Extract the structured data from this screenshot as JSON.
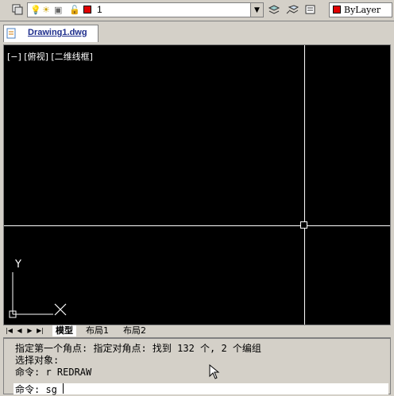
{
  "toolbar": {
    "layer_name": "1",
    "color_label": "ByLayer",
    "colors": {
      "layer_swatch": "#e00000",
      "color_swatch": "#e00000"
    }
  },
  "document": {
    "tab_label": "Drawing1.dwg"
  },
  "viewport": {
    "label": "[−] [俯视] [二维线框]"
  },
  "ucs": {
    "y_label": "Y"
  },
  "layouts": {
    "tabs": [
      "模型",
      "布局1",
      "布局2"
    ]
  },
  "command": {
    "history": [
      "指定第一个角点: 指定对角点: 找到 132 个, 2 个编组",
      "选择对象:",
      "命令: r REDRAW"
    ],
    "prompt": "命令: sg"
  }
}
